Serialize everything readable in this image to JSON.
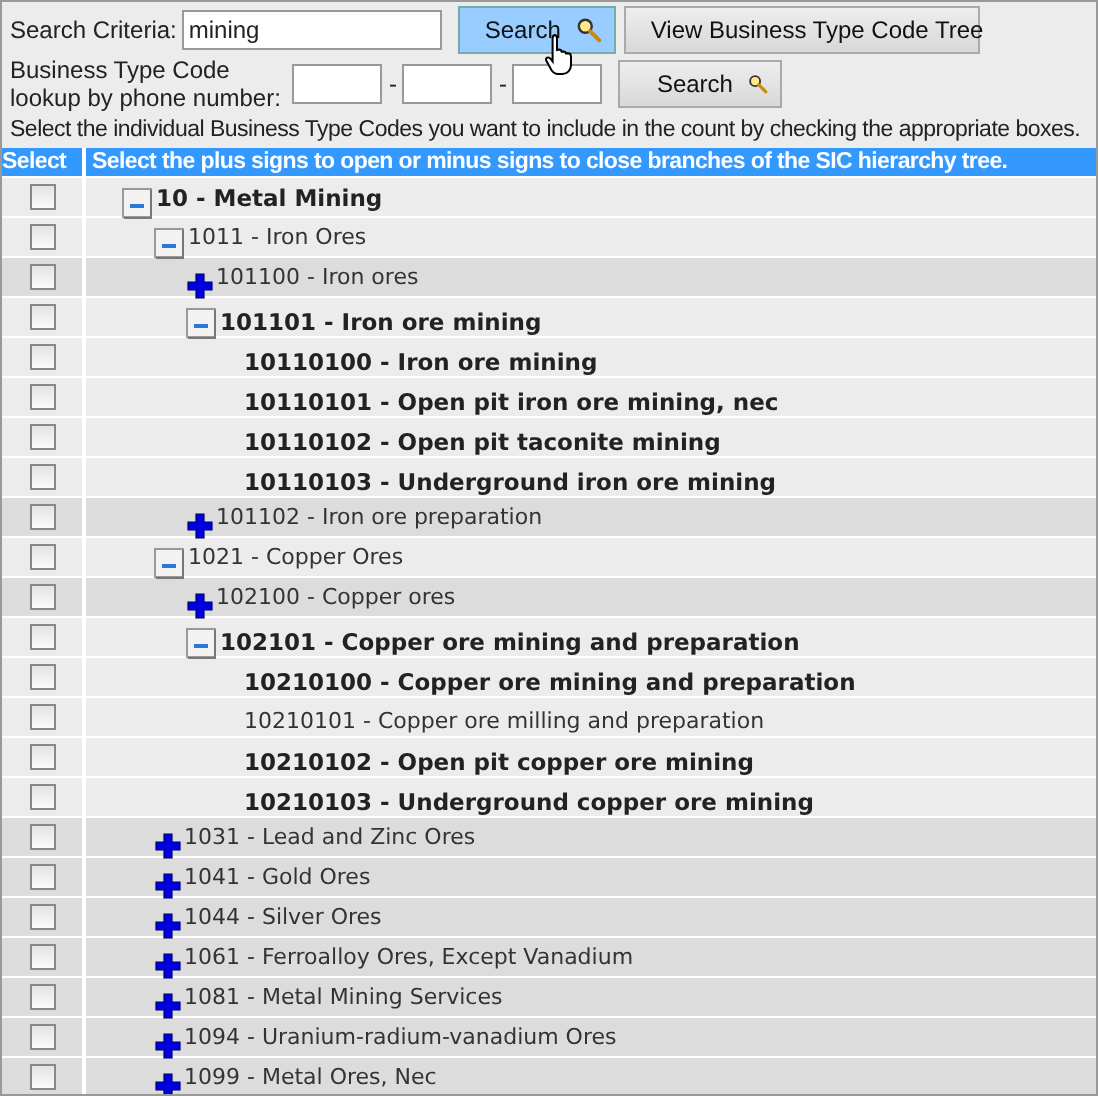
{
  "search": {
    "label": "Search Criteria:",
    "value": "mining",
    "button": "Search",
    "tree_button": "View Business Type Code Tree"
  },
  "phone_lookup": {
    "label_lines": [
      "Business Type Code",
      "lookup by phone number:"
    ],
    "separators": [
      "-",
      "-"
    ],
    "button": "Search"
  },
  "instructions": "Select the individual Business Type Codes you want to include in the count by checking the appropriate boxes.",
  "table": {
    "columns": [
      "Select",
      "Select the plus signs to open or minus signs to close branches of the SIC hierarchy tree."
    ],
    "rows": [
      {
        "label": "10 - Metal Mining",
        "kind": "branch",
        "expanded": true,
        "bold": true,
        "checked": false,
        "children": [
          {
            "label": "1011 - Iron Ores",
            "kind": "branch",
            "expanded": true,
            "bold": false,
            "checked": false,
            "children": [
              {
                "label": "101100 - Iron ores",
                "kind": "branch",
                "expanded": false,
                "bold": false,
                "checked": false
              },
              {
                "label": "101101 - Iron ore mining",
                "kind": "branch",
                "expanded": true,
                "bold": true,
                "checked": false,
                "children": [
                  {
                    "label": "10110100 - Iron ore mining",
                    "kind": "leaf",
                    "bold": true,
                    "checked": false
                  },
                  {
                    "label": "10110101 - Open pit iron ore mining, nec",
                    "kind": "leaf",
                    "bold": true,
                    "checked": false
                  },
                  {
                    "label": "10110102 - Open pit taconite mining",
                    "kind": "leaf",
                    "bold": true,
                    "checked": false
                  },
                  {
                    "label": "10110103 - Underground iron ore mining",
                    "kind": "leaf",
                    "bold": true,
                    "checked": false
                  }
                ]
              },
              {
                "label": "101102 - Iron ore preparation",
                "kind": "branch",
                "expanded": false,
                "bold": false,
                "checked": false
              }
            ]
          },
          {
            "label": "1021 - Copper Ores",
            "kind": "branch",
            "expanded": true,
            "bold": false,
            "checked": false,
            "children": [
              {
                "label": "102100 - Copper ores",
                "kind": "branch",
                "expanded": false,
                "bold": false,
                "checked": false
              },
              {
                "label": "102101 - Copper ore mining and preparation",
                "kind": "branch",
                "expanded": true,
                "bold": true,
                "checked": false,
                "children": [
                  {
                    "label": "10210100 - Copper ore mining and preparation",
                    "kind": "leaf",
                    "bold": true,
                    "checked": false
                  },
                  {
                    "label": "10210101 - Copper ore milling and preparation",
                    "kind": "leaf",
                    "bold": false,
                    "checked": false
                  },
                  {
                    "label": "10210102 - Open pit copper ore mining",
                    "kind": "leaf",
                    "bold": true,
                    "checked": false
                  },
                  {
                    "label": "10210103 - Underground copper ore mining",
                    "kind": "leaf",
                    "bold": true,
                    "checked": false
                  }
                ]
              }
            ]
          },
          {
            "label": "1031 - Lead and Zinc Ores",
            "kind": "branch",
            "expanded": false,
            "bold": false,
            "checked": false
          },
          {
            "label": "1041 - Gold Ores",
            "kind": "branch",
            "expanded": false,
            "bold": false,
            "checked": false
          },
          {
            "label": "1044 - Silver Ores",
            "kind": "branch",
            "expanded": false,
            "bold": false,
            "checked": false
          },
          {
            "label": "1061 - Ferroalloy Ores, Except Vanadium",
            "kind": "branch",
            "expanded": false,
            "bold": false,
            "checked": false
          },
          {
            "label": "1081 - Metal Mining Services",
            "kind": "branch",
            "expanded": false,
            "bold": false,
            "checked": false
          },
          {
            "label": "1094 - Uranium-radium-vanadium Ores",
            "kind": "branch",
            "expanded": false,
            "bold": false,
            "checked": false
          },
          {
            "label": "1099 - Metal Ores, Nec",
            "kind": "branch",
            "expanded": false,
            "bold": false,
            "checked": false
          }
        ]
      }
    ]
  }
}
